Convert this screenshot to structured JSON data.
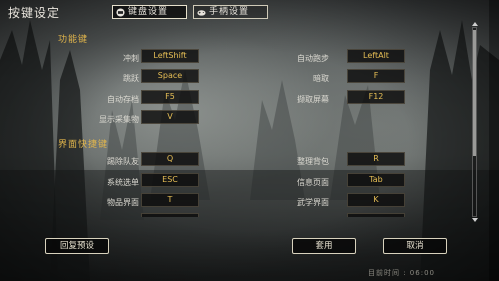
{
  "window": {
    "title": "按键设定"
  },
  "tabs": [
    {
      "label": "键盘设置",
      "icon": "keyboard-icon",
      "active": true
    },
    {
      "label": "手柄设置",
      "icon": "gamepad-icon",
      "active": false
    }
  ],
  "sections": [
    {
      "title": "功能键",
      "rows": [
        {
          "left_label": "冲刺",
          "left_key": "LeftShift",
          "right_label": "自动跑步",
          "right_key": "LeftAlt"
        },
        {
          "left_label": "跳跃",
          "left_key": "Space",
          "right_label": "暗取",
          "right_key": "F"
        },
        {
          "left_label": "自动存档",
          "left_key": "F5",
          "right_label": "撷取屏幕",
          "right_key": "F12"
        },
        {
          "left_label": "显示采集物",
          "left_key": "V"
        }
      ]
    },
    {
      "title": "界面快捷键",
      "rows": [
        {
          "left_label": "踢除队友",
          "left_key": "Q",
          "right_label": "整理背包",
          "right_key": "R"
        },
        {
          "left_label": "系统选单",
          "left_key": "ESC",
          "right_label": "信息页面",
          "right_key": "Tab"
        },
        {
          "left_label": "物品界面",
          "left_key": "T",
          "right_label": "武学界面",
          "right_key": "K"
        }
      ]
    }
  ],
  "buttons": {
    "reset": "回复预设",
    "apply": "套用",
    "cancel": "取消"
  },
  "status_text": "目前时间 : 06:00",
  "colors": {
    "accent_gold": "#e2b64c",
    "key_text": "#e6be55",
    "label_text": "#dcdad2"
  }
}
